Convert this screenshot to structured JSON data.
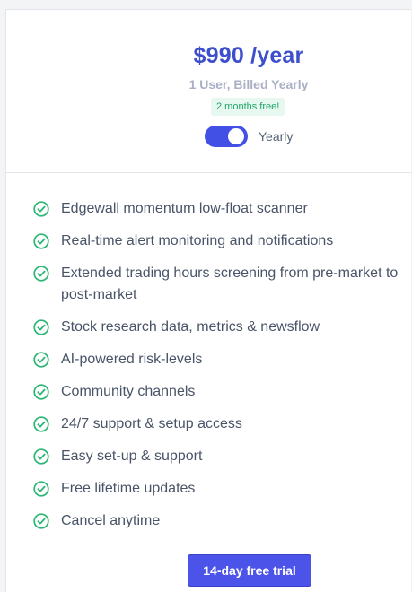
{
  "pricing": {
    "price": "$990 /year",
    "subtitle": "1 User, Billed Yearly",
    "badge": "2 months free!",
    "toggle_label": "Yearly",
    "toggle_on": true
  },
  "colors": {
    "accent": "#4250e6",
    "price": "#3d4fcc",
    "check": "#2bb673",
    "badge_text": "#22a36a",
    "badge_bg": "#e6f8ef"
  },
  "features": [
    "Edgewall momentum low-float scanner",
    "Real-time alert monitoring and notifications",
    "Extended trading hours screening from pre-market to post-market",
    "Stock research data, metrics & newsflow",
    "AI-powered risk-levels",
    "Community channels",
    "24/7 support & setup access",
    "Easy set-up & support",
    "Free lifetime updates",
    "Cancel anytime"
  ],
  "icons": {
    "feature_icon": "check-circle-icon"
  },
  "cta": {
    "label": "14-day free trial"
  }
}
